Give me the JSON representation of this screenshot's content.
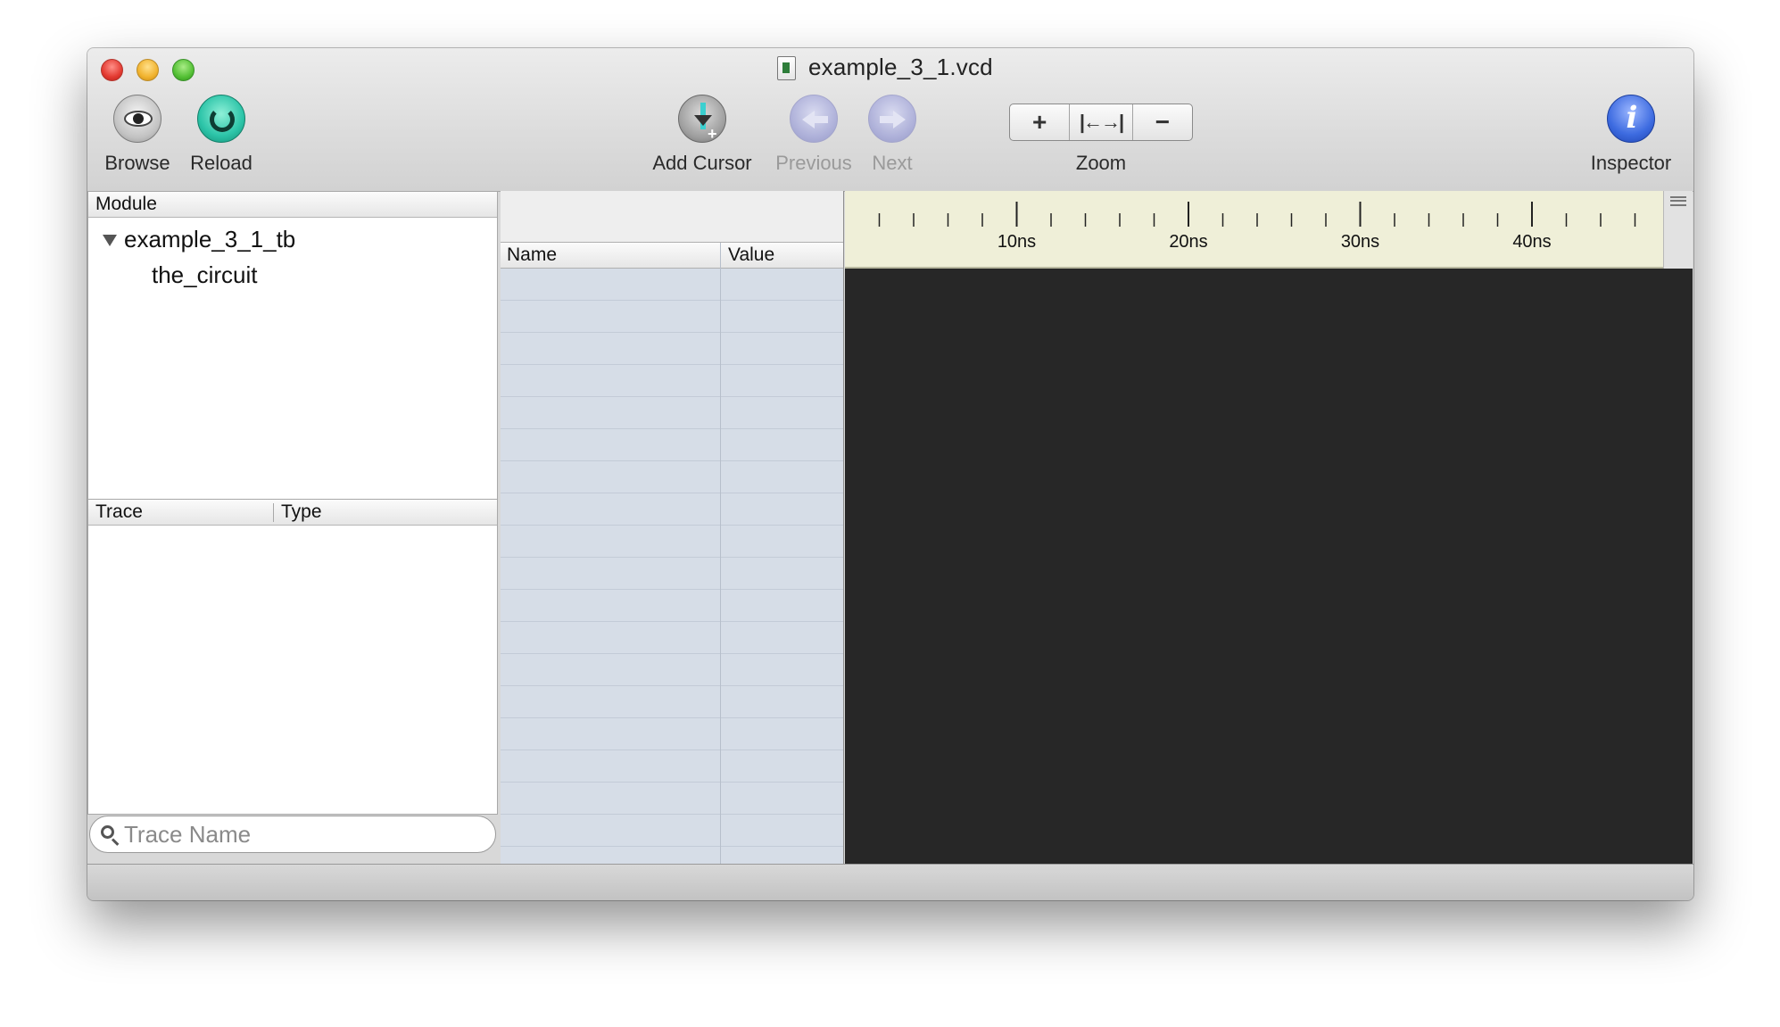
{
  "window": {
    "title": "example_3_1.vcd",
    "document_icon": "vcd-document-icon"
  },
  "toolbar": {
    "browse": {
      "label": "Browse",
      "icon": "eye-icon"
    },
    "reload": {
      "label": "Reload",
      "icon": "reload-icon"
    },
    "add_cursor": {
      "label": "Add Cursor",
      "icon": "add-cursor-icon"
    },
    "previous": {
      "label": "Previous",
      "icon": "left-arrow-icon",
      "enabled": false
    },
    "next": {
      "label": "Next",
      "icon": "right-arrow-icon",
      "enabled": false
    },
    "zoom": {
      "label": "Zoom",
      "in": "+",
      "fit": "|←→|",
      "out": "−"
    },
    "inspector": {
      "label": "Inspector",
      "icon": "info-icon"
    }
  },
  "module_panel": {
    "header": "Module",
    "tree": [
      {
        "label": "example_3_1_tb",
        "expanded": true,
        "children": [
          {
            "label": "the_circuit"
          }
        ]
      }
    ]
  },
  "trace_panel": {
    "columns": [
      "Trace",
      "Type"
    ],
    "rows": []
  },
  "search": {
    "placeholder": "Trace Name",
    "value": ""
  },
  "signal_table": {
    "columns": [
      "Name",
      "Value"
    ],
    "rows": []
  },
  "timeline": {
    "labels": [
      "10ns",
      "20ns",
      "30ns",
      "40ns"
    ],
    "range_ns": [
      0,
      48
    ],
    "minor_tick_ns": 2,
    "major_tick_ns": 10
  },
  "colors": {
    "waveform_background": "#272727",
    "ruler_background": "#efefd8",
    "signal_list_background": "#d6dde7"
  }
}
